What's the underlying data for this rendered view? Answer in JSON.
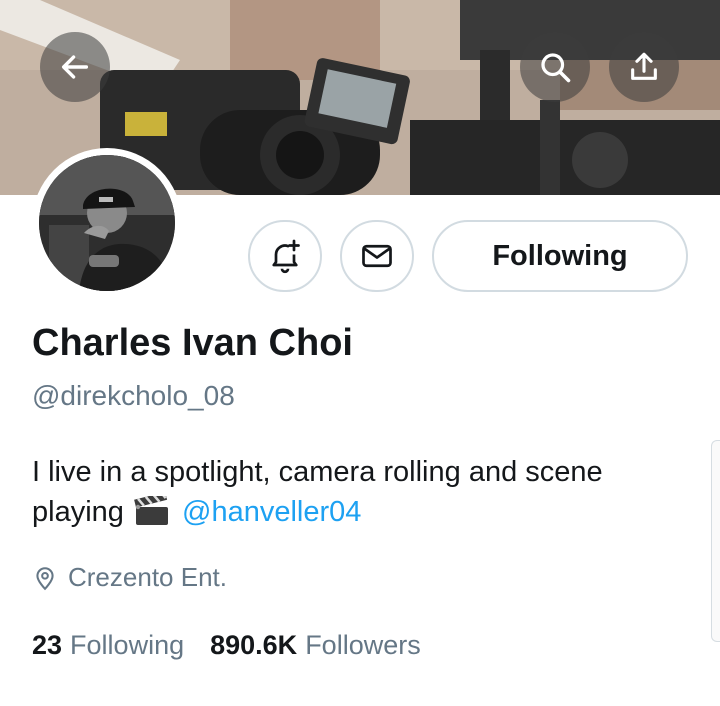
{
  "header": {
    "back_icon": "arrow-left-icon",
    "search_icon": "search-icon",
    "share_icon": "share-icon"
  },
  "profile": {
    "name": "Charles Ivan Choi",
    "handle": "@direkcholo_08",
    "bio_text": "I live in a spotlight, camera rolling and scene playing",
    "bio_emoji": "clapper-board-icon",
    "bio_mention": "@hanveller04",
    "location": "Crezento Ent.",
    "following_count": "23",
    "following_label": "Following",
    "followers_count": "890.6K",
    "followers_label": "Followers"
  },
  "actions": {
    "notify_icon": "bell-plus-icon",
    "message_icon": "mail-icon",
    "follow_button_label": "Following"
  },
  "colors": {
    "link": "#1da1f2",
    "secondary_text": "#657786",
    "primary_text": "#14171a",
    "button_border": "#d2dbe1"
  }
}
